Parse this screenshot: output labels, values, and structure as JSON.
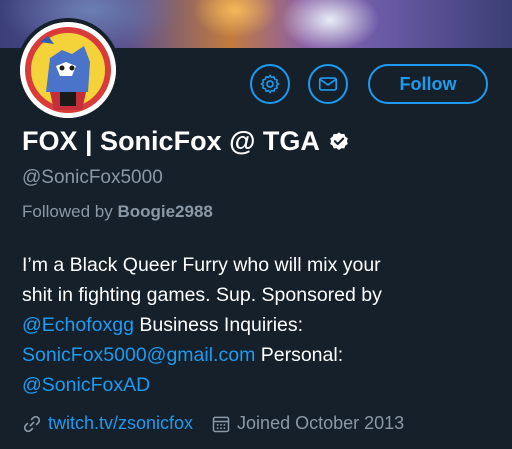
{
  "profile": {
    "display_name": "FOX | SonicFox @ TGA",
    "handle": "@SonicFox5000",
    "followed_by_prefix": "Followed by",
    "followed_by_user": "Boogie2988",
    "bio": {
      "line1": "I’m a Black Queer Furry who will mix your",
      "line2": "shit in fighting games. Sup. Sponsored by",
      "line3_mention": "@Echofoxgg",
      "line3_text": " Business Inquiries:",
      "line4_email": "SonicFox5000@gmail.com",
      "line4_text": " Personal:",
      "line5_mention": "@SonicFoxAD"
    },
    "website": "twitch.tv/zsonicfox",
    "joined": "Joined October 2013"
  },
  "actions": {
    "follow_label": "Follow",
    "settings_icon": "gear-icon",
    "message_icon": "envelope-icon"
  },
  "icons": {
    "verified": "verified-badge-icon",
    "link": "link-icon",
    "calendar": "calendar-icon"
  },
  "colors": {
    "background": "#15202b",
    "accent": "#1d9bf0",
    "secondary_text": "#8b98a5",
    "primary_text": "#ffffff"
  }
}
